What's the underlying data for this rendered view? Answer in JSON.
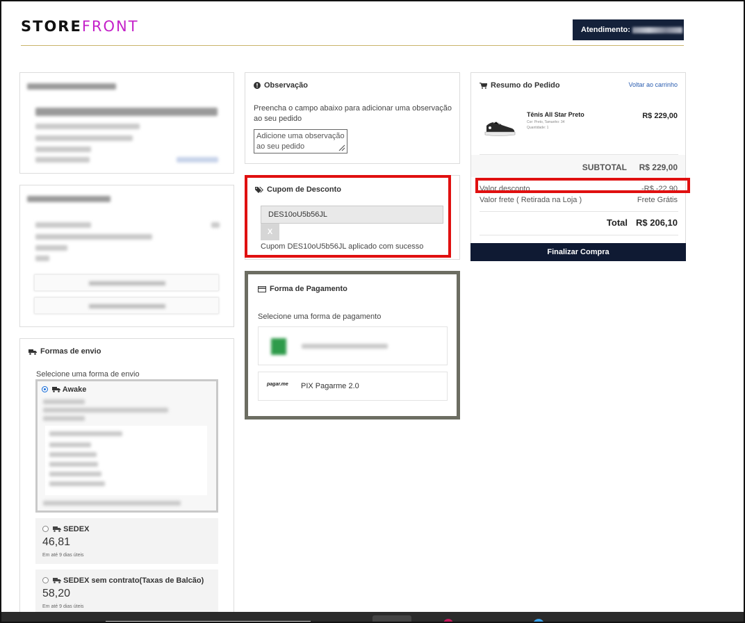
{
  "header": {
    "logo_part1": "STORE",
    "logo_part2": "FRONT",
    "attend_label": "Atendimento:"
  },
  "observacao": {
    "title": "Observação",
    "text": "Preencha o campo abaixo para adicionar uma observação ao seu pedido",
    "placeholder": "Adicione uma observação ao seu pedido"
  },
  "cupom": {
    "title": "Cupom de Desconto",
    "code": "DES10oU5b56JL",
    "remove_label": "X",
    "success_msg": "Cupom DES10oU5b56JL aplicado com sucesso"
  },
  "pagamento": {
    "title": "Forma de Pagamento",
    "subtitle": "Selecione uma forma de pagamento",
    "pix_logo": "pagar.me",
    "pix_label": "PIX Pagarme 2.0"
  },
  "resumo": {
    "title": "Resumo do Pedido",
    "back_link": "Voltar ao carrinho",
    "product": {
      "name": "Tênis All Star Preto",
      "color": "Cor: Preto, Tamanho: 34",
      "qty": "Quantidade: 1",
      "price": "R$ 229,00"
    },
    "subtotal_label": "SUBTOTAL",
    "subtotal_value": "R$ 229,00",
    "discount_label": "Valor desconto",
    "discount_value": "-R$ -22,90",
    "shipping_label": "Valor frete ( Retirada na Loja )",
    "shipping_value": "Frete Grátis",
    "total_label": "Total",
    "total_value": "R$ 206,10",
    "checkout_label": "Finalizar Compra"
  },
  "envio": {
    "title": "Formas de envio",
    "subtitle": "Selecione uma forma de envio",
    "options": [
      {
        "name": "Awake"
      },
      {
        "name": "SEDEX",
        "price": "46,81",
        "days": "Em até 9 dias úteis"
      },
      {
        "name": "SEDEX sem contrato(Taxas de Balcão)",
        "price": "58,20",
        "days": "Em até 9 dias úteis"
      }
    ]
  },
  "colors": {
    "accent": "#c421c9",
    "navy": "#0f1a33",
    "highlight_red": "#e01010",
    "payment_border": "#6c6d62"
  }
}
